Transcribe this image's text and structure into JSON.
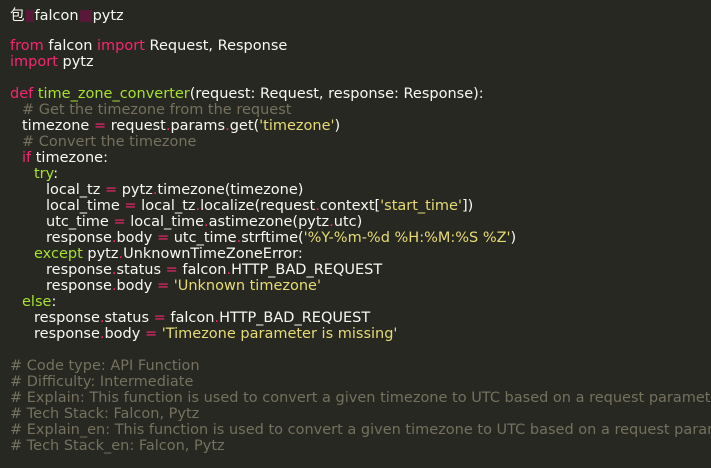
{
  "header": {
    "prefix": "包",
    "lib1": "falcon",
    "lib2": "pytz"
  },
  "code": {
    "l1": {
      "kw1": "from",
      "mod": " falcon ",
      "kw2": "import",
      "rest": " Request, Response"
    },
    "l2": {
      "kw": "import",
      "rest": " pytz"
    },
    "l3": {
      "kw": "def",
      "name": " time_zone_converter",
      "rest": "(request: Request, response: Response):"
    },
    "l4": "# Get the timezone from the request",
    "l5": {
      "a": "timezone ",
      "op": "=",
      "b": " request",
      "dot1": ".",
      "c": "params",
      "dot2": ".",
      "d": "get(",
      "str": "'timezone'",
      "e": ")"
    },
    "l6": "# Convert the timezone",
    "l7": {
      "kw": "if",
      "rest": " timezone:"
    },
    "l8": {
      "kw": "try",
      "rest": ":"
    },
    "l9": {
      "a": "local_tz ",
      "op": "=",
      "b": " pytz",
      "dot": ".",
      "c": "timezone(timezone)"
    },
    "l10": {
      "a": "local_time ",
      "op": "=",
      "b": " local_tz",
      "dot1": ".",
      "c": "localize(request",
      "dot2": ".",
      "d": "context[",
      "str": "'start_time'",
      "e": "])"
    },
    "l11": {
      "a": "utc_time ",
      "op": "=",
      "b": " local_time",
      "dot1": ".",
      "c": "astimezone(pytz",
      "dot2": ".",
      "d": "utc)"
    },
    "l12": {
      "a": "response",
      "dot1": ".",
      "b": "body ",
      "op": "=",
      "c": " utc_time",
      "dot2": ".",
      "d": "strftime(",
      "str": "'%Y-%m-%d %H:%M:%S %Z'",
      "e": ")"
    },
    "l13": {
      "kw": "except",
      "b": " pytz",
      "dot": ".",
      "c": "UnknownTimeZoneError:"
    },
    "l14": {
      "a": "response",
      "dot1": ".",
      "b": "status ",
      "op": "=",
      "c": " falcon",
      "dot2": ".",
      "d": "HTTP_BAD_REQUEST"
    },
    "l15": {
      "a": "response",
      "dot1": ".",
      "b": "body ",
      "op": "=",
      "str": " 'Unknown timezone'"
    },
    "l16": {
      "kw": "else",
      "rest": ":"
    },
    "l17": {
      "a": "response",
      "dot1": ".",
      "b": "status ",
      "op": "=",
      "c": " falcon",
      "dot2": ".",
      "d": "HTTP_BAD_REQUEST"
    },
    "l18": {
      "a": "response",
      "dot1": ".",
      "b": "body ",
      "op": "=",
      "str": " 'Timezone parameter is missing'"
    }
  },
  "comments": [
    "# Code type: API Function",
    "# Difficulty: Intermediate",
    "# Explain: This function is used to convert a given timezone to UTC based on a request parameter.",
    "# Tech Stack: Falcon, Pytz",
    "# Explain_en: This function is used to convert a given timezone to UTC based on a request parameter.",
    "# Tech Stack_en: Falcon, Pytz"
  ],
  "colors": {
    "background": "#272822",
    "keyword": "#f92672",
    "function": "#a6e22e",
    "string": "#e6db74",
    "comment": "#75715e",
    "text": "#f8f8f2"
  }
}
